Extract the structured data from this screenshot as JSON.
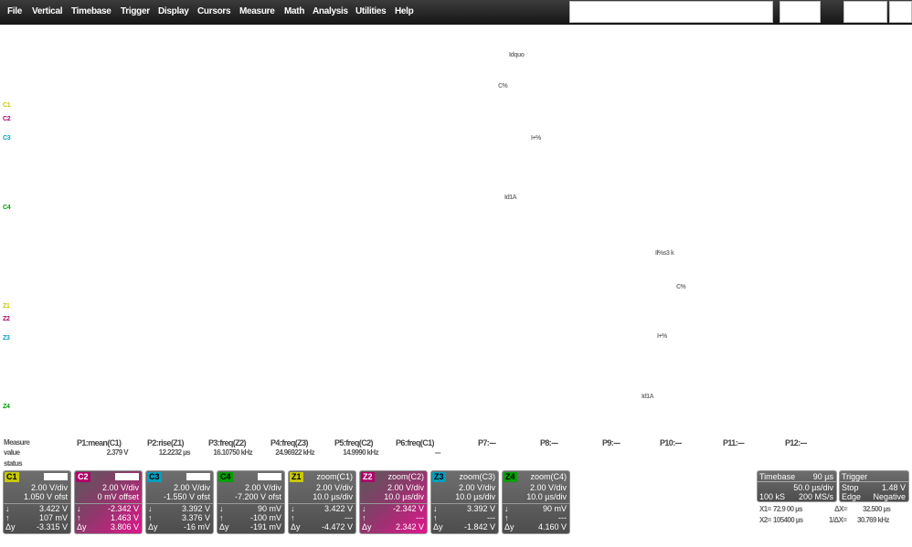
{
  "menu": [
    "File",
    "Vertical",
    "Timebase",
    "Trigger",
    "Display",
    "Cursors",
    "Measure",
    "Math",
    "Analysis",
    "Utilities",
    "Help"
  ],
  "trace_labels": {
    "c1": "C1",
    "c2": "C2",
    "c3": "C3",
    "c4": "C4",
    "z1": "Z1",
    "z2": "Z2",
    "z3": "Z3",
    "z4": "Z4"
  },
  "colors": {
    "c1": "#c8c800",
    "c2": "#b0006a",
    "c3": "#00a0c0",
    "c4": "#00a000",
    "magenta_box": "#e0168c"
  },
  "grid_annotations": {
    "upper": [
      "Idquo",
      "C%",
      "I+%",
      "Id1A"
    ],
    "lower": [
      "Il%s3 k",
      "C%",
      "I+%",
      "Id1A"
    ]
  },
  "measure": {
    "row_labels": [
      "Measure",
      "value",
      "status"
    ],
    "params": [
      "P1:mean(C1)",
      "P2:rise(Z1)",
      "P3:freq(Z2)",
      "P4:freq(Z3)",
      "P5:freq(C2)",
      "P6:freq(C1)",
      "P7:---",
      "P8:---",
      "P9:---",
      "P10:---",
      "P11:---",
      "P12:---"
    ],
    "values": [
      "2.379 V",
      "12.2232 µs",
      "16.10750 kHz",
      "24.96922 kHz",
      "14.9990 kHz",
      "---",
      "",
      "",
      "",
      "",
      "",
      ""
    ]
  },
  "channels": [
    {
      "tag": "C1",
      "title": "",
      "scale": "2.00 V/div",
      "offset": "1.050 V ofst",
      "down": "3.422 V",
      "up": "107 mV",
      "dy": "-3.315 V"
    },
    {
      "tag": "C2",
      "title": "",
      "scale": "2.00 V/div",
      "offset": "0 mV offset",
      "down": "-2.342 V",
      "up": "1.463 V",
      "dy": "3.806 V"
    },
    {
      "tag": "C3",
      "title": "",
      "scale": "2.00 V/div",
      "offset": "-1.550 V ofst",
      "down": "3.392 V",
      "up": "3.376 V",
      "dy": "-16 mV"
    },
    {
      "tag": "C4",
      "title": "",
      "scale": "2.00 V/div",
      "offset": "-7.200 V ofst",
      "down": "90 mV",
      "up": "-100 mV",
      "dy": "-191 mV"
    },
    {
      "tag": "Z1",
      "title": "zoom(C1)",
      "scale": "2.00 V/div",
      "offset": "10.0 µs/div",
      "down": "3.422 V",
      "up": "---",
      "dy": "-4.472 V"
    },
    {
      "tag": "Z2",
      "title": "zoom(C2)",
      "scale": "2.00 V/div",
      "offset": "10.0 µs/div",
      "down": "-2.342 V",
      "up": "---",
      "dy": "2.342 V"
    },
    {
      "tag": "Z3",
      "title": "zoom(C3)",
      "scale": "2.00 V/div",
      "offset": "10.0 µs/div",
      "down": "3.392 V",
      "up": "---",
      "dy": "-1.842 V"
    },
    {
      "tag": "Z4",
      "title": "zoom(C4)",
      "scale": "2.00 V/div",
      "offset": "10.0 µs/div",
      "down": "90 mV",
      "up": "---",
      "dy": "4.160 V"
    }
  ],
  "channel_symbols": {
    "down": "↓",
    "up": "↑",
    "dy": "Δy"
  },
  "timebase": {
    "label": "Timebase",
    "delay": "90 µs",
    "per_div": "50.0 µs/div",
    "samples": "100 kS",
    "rate": "200 MS/s"
  },
  "trigger": {
    "label": "Trigger",
    "mode": "Stop",
    "level": "1.48 V",
    "type": "Edge",
    "slope": "Negative"
  },
  "cursors": [
    {
      "label": "X1=",
      "value": "72.9 00 µs",
      "label2": "ΔX=",
      "value2": "32.500 µs"
    },
    {
      "label": "X2=",
      "value": "105400 µs",
      "label2": "1/ΔX=",
      "value2": "30.769 kHz"
    }
  ]
}
